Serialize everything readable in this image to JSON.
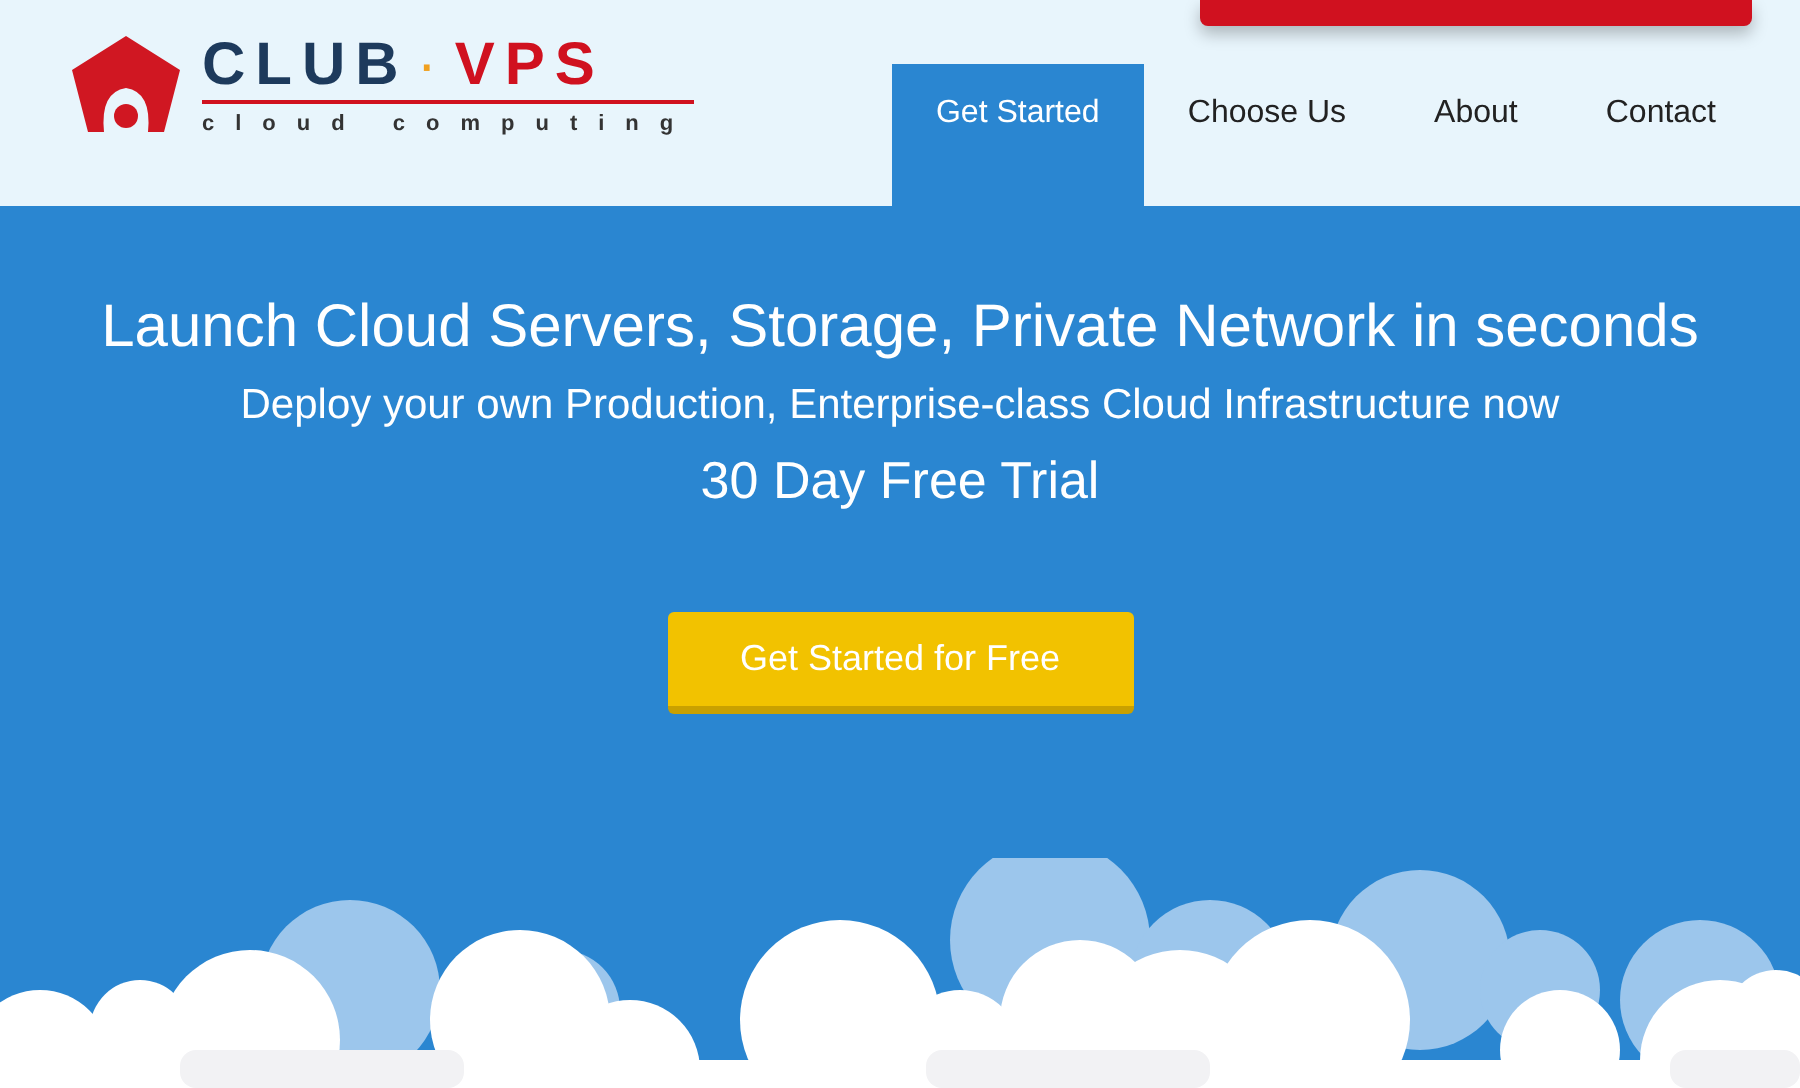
{
  "logo": {
    "name_left": "CLUB",
    "separator": "·",
    "name_right": "VPS",
    "tagline": "cloud computing"
  },
  "nav": [
    {
      "label": "Get Started",
      "selected": true
    },
    {
      "label": "Choose Us",
      "selected": false
    },
    {
      "label": "About",
      "selected": false
    },
    {
      "label": "Contact",
      "selected": false
    }
  ],
  "hero": {
    "title": "Launch Cloud Servers, Storage, Private Network in seconds",
    "subtitle": "Deploy your own Production, Enterprise-class Cloud Infrastructure now",
    "offer": "30 Day Free Trial",
    "button": "Get Started for Free"
  }
}
